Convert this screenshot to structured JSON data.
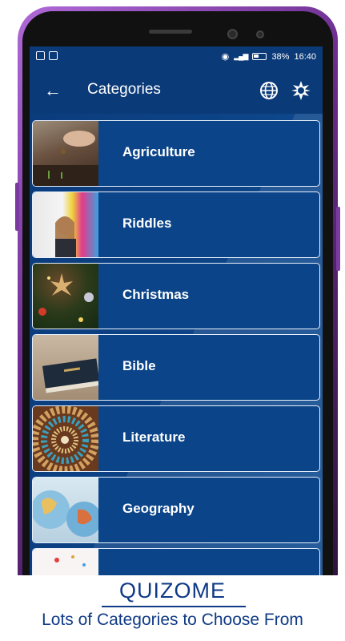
{
  "status": {
    "battery": "38%",
    "time": "16:40"
  },
  "appbar": {
    "title": "Categories"
  },
  "categories": [
    {
      "label": "Agriculture"
    },
    {
      "label": "Riddles"
    },
    {
      "label": "Christmas"
    },
    {
      "label": "Bible"
    },
    {
      "label": "Literature"
    },
    {
      "label": "Geography"
    },
    {
      "label": ""
    }
  ],
  "banner": {
    "brand": "QUIZOME",
    "tagline": "Lots of Categories to Choose From"
  },
  "colors": {
    "primary": "#0b3a78",
    "card": "#0b4489",
    "brand_text": "#0f3a86"
  }
}
